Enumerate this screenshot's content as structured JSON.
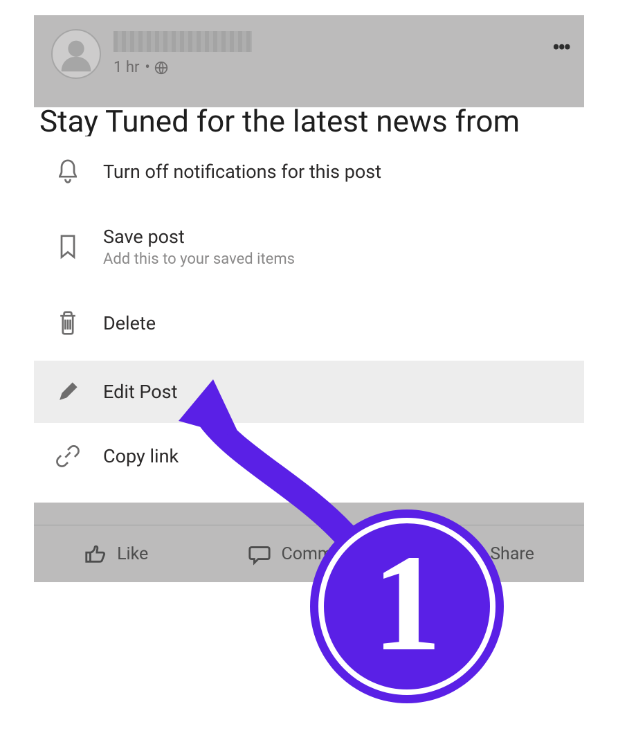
{
  "post": {
    "timestamp": "1 hr",
    "separator": "•",
    "headline_peek": "Stay Tuned for the latest news from"
  },
  "menu": {
    "notifications": {
      "label": "Turn off notifications for this post"
    },
    "save": {
      "label": "Save post",
      "sub": "Add this to your saved items"
    },
    "delete": {
      "label": "Delete"
    },
    "edit": {
      "label": "Edit Post"
    },
    "copy": {
      "label": "Copy link"
    }
  },
  "footer": {
    "like": "Like",
    "comment": "Comment",
    "share": "Share"
  },
  "annotation": {
    "step_number": "1"
  }
}
